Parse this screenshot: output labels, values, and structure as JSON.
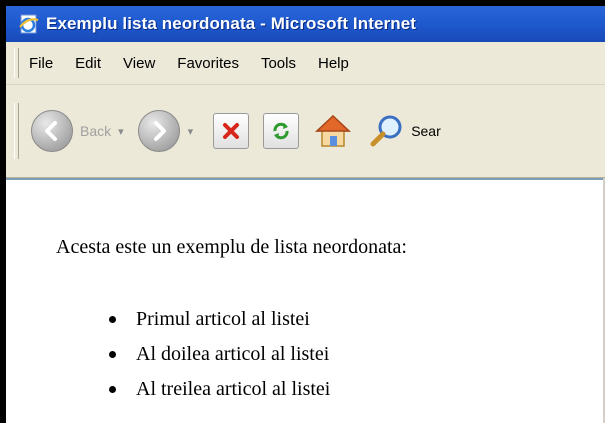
{
  "window": {
    "title": "Exemplu lista neordonata - Microsoft Internet"
  },
  "menubar": {
    "items": [
      "File",
      "Edit",
      "View",
      "Favorites",
      "Tools",
      "Help"
    ]
  },
  "toolbar": {
    "back_label": "Back",
    "dropdown_glyph": "▾",
    "search_label": "Sear"
  },
  "icons": {
    "title": "ie-page-icon",
    "back": "back-arrow-icon",
    "forward": "forward-arrow-icon",
    "stop": "stop-icon",
    "refresh": "refresh-icon",
    "home": "home-icon",
    "search": "search-icon"
  },
  "content": {
    "intro": "Acesta este un exemplu de lista neordonata:",
    "items": [
      "Primul articol al listei",
      "Al doilea articol al listei",
      "Al treilea articol al listei"
    ]
  },
  "colors": {
    "titlebar": "#1f5bd0",
    "chrome": "#ece9d8",
    "stop": "#d7261b",
    "refresh": "#2e9a2e"
  }
}
